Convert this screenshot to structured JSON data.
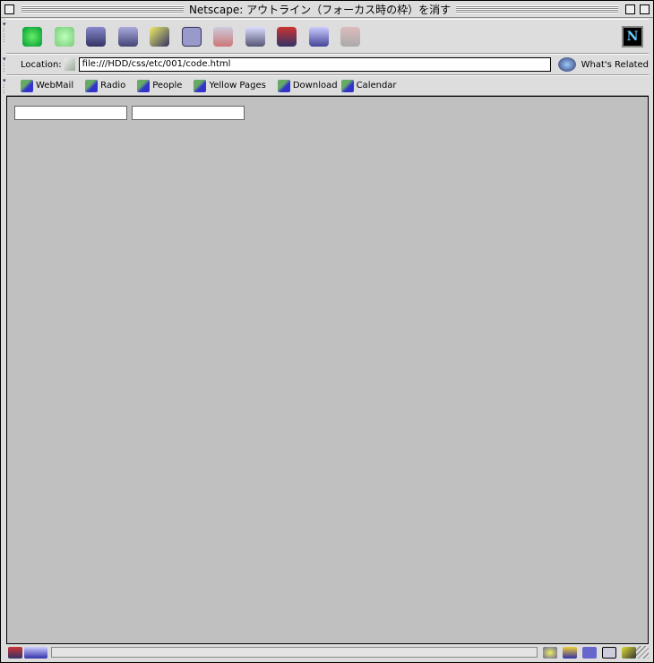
{
  "window": {
    "title": "Netscape: アウトライン（フォーカス時の枠）を消す"
  },
  "toolbar": {
    "icons": [
      "back-icon",
      "forward-icon",
      "reload-icon",
      "home-icon",
      "search-icon",
      "my-netscape-icon",
      "images-icon",
      "print-icon",
      "security-icon",
      "shop-icon",
      "stop-icon"
    ],
    "logo": "N"
  },
  "location": {
    "label": "Location:",
    "url": "file:///HDD/css/etc/001/code.html",
    "whats_related": "What's Related"
  },
  "personal": {
    "items": [
      "WebMail",
      "Radio",
      "People",
      "Yellow Pages",
      "Download",
      "Calendar"
    ]
  },
  "colors": {
    "content_bg": "#c0c0c0",
    "chrome": "#dddddd"
  }
}
